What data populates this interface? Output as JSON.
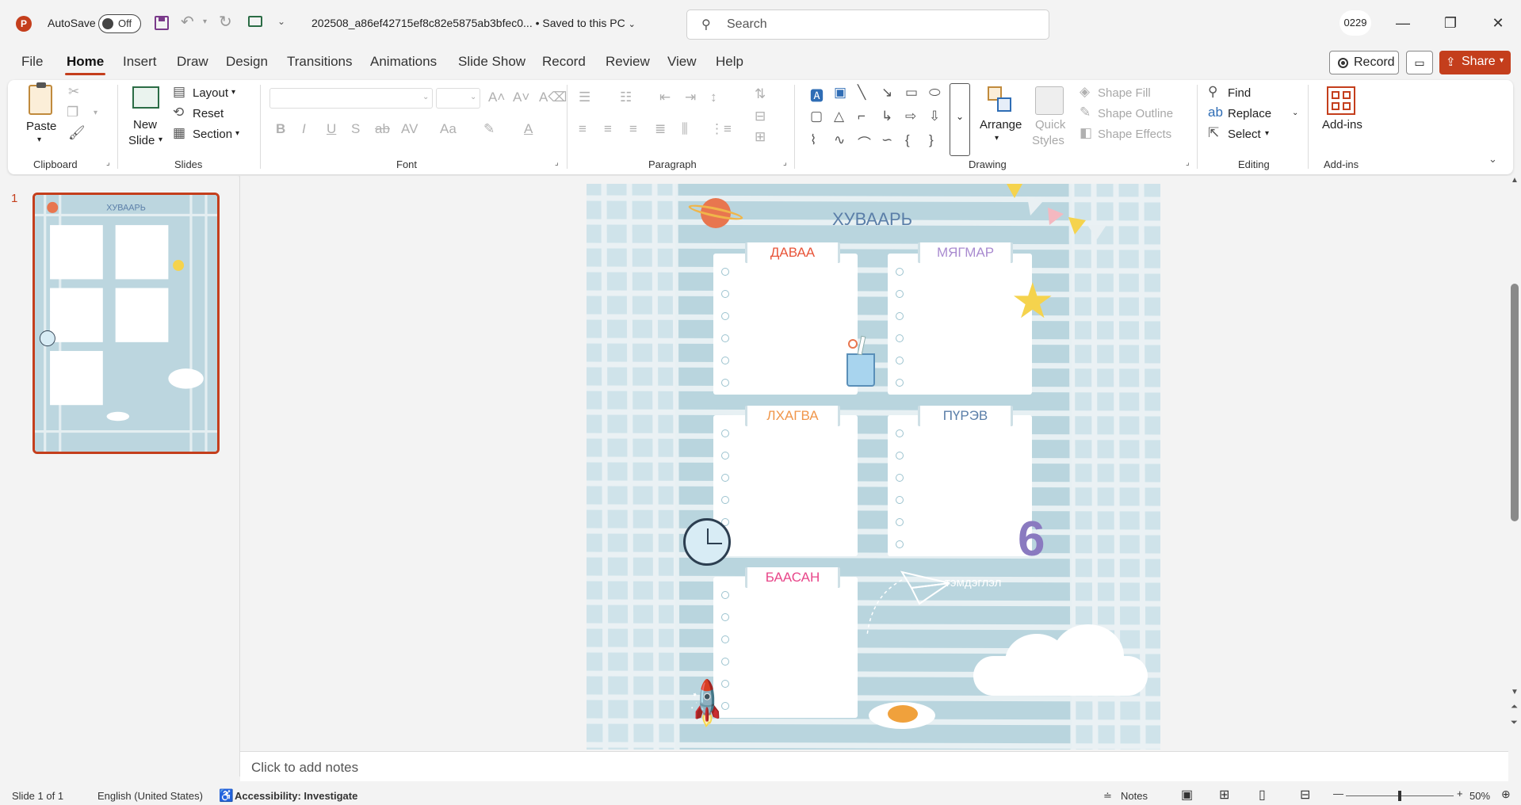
{
  "titlebar": {
    "autosave_label": "AutoSave",
    "autosave_state": "Off",
    "filename": "202508_a86ef42715ef8c82e5875ab3bfec0...",
    "save_state": "• Saved to this PC",
    "search_placeholder": "Search",
    "user_initials": "0229",
    "app_icon": "powerpoint-icon"
  },
  "menu": {
    "tabs": [
      "File",
      "Home",
      "Insert",
      "Draw",
      "Design",
      "Transitions",
      "Animations",
      "Slide Show",
      "Record",
      "Review",
      "View",
      "Help"
    ],
    "active_tab": "Home",
    "record_label": "Record",
    "share_label": "Share"
  },
  "ribbon": {
    "clipboard": {
      "paste": "Paste",
      "group": "Clipboard"
    },
    "slides": {
      "new_slide_1": "New",
      "new_slide_2": "Slide",
      "layout": "Layout",
      "reset": "Reset",
      "section": "Section",
      "group": "Slides"
    },
    "font": {
      "group": "Font",
      "bold": "B",
      "italic": "I",
      "underline": "U",
      "shadow": "S",
      "strike": "ab",
      "spacing": "AV",
      "case": "Aa"
    },
    "paragraph": {
      "group": "Paragraph"
    },
    "drawing": {
      "arrange": "Arrange",
      "quick_styles_1": "Quick",
      "quick_styles_2": "Styles",
      "shape_fill": "Shape Fill",
      "shape_outline": "Shape Outline",
      "shape_effects": "Shape Effects",
      "group": "Drawing"
    },
    "editing": {
      "find": "Find",
      "replace": "Replace",
      "select": "Select",
      "group": "Editing"
    },
    "addins": {
      "label": "Add-ins",
      "group": "Add-ins"
    }
  },
  "thumbnails": {
    "slide_number": "1"
  },
  "slide": {
    "title": "ХУВААРЬ",
    "days": [
      {
        "name": "ДАВАА",
        "color": "#e8553a"
      },
      {
        "name": "МЯГМАР",
        "color": "#a98bd0"
      },
      {
        "name": "ЛХАГВА",
        "color": "#f0964a"
      },
      {
        "name": "ПҮРЭВ",
        "color": "#5a7ea8"
      },
      {
        "name": "БААСАН",
        "color": "#e8478a"
      }
    ],
    "note_label": "тэмдэглэл"
  },
  "notes_placeholder": "Click to add notes",
  "status": {
    "slide_info": "Slide 1 of 1",
    "language": "English (United States)",
    "accessibility": "Accessibility: Investigate",
    "notes": "Notes",
    "zoom": "50%"
  },
  "colors": {
    "accent": "#c43e1c",
    "slide_bg": "#b9d5de"
  }
}
